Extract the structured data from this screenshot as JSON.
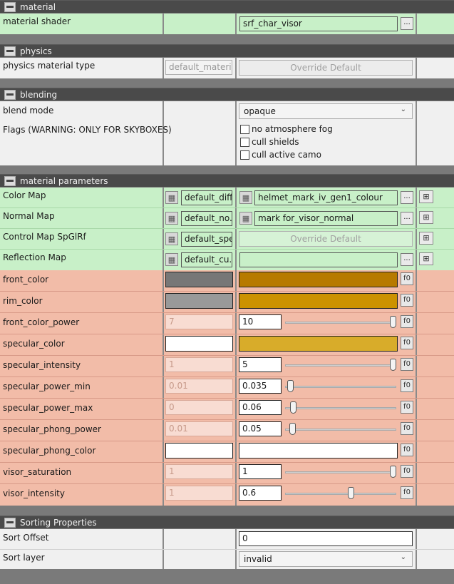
{
  "sections": {
    "material": "material",
    "physics": "physics",
    "blending": "blending",
    "params": "material parameters",
    "sorting": "Sorting Properties"
  },
  "material": {
    "shader_label": "material shader",
    "shader_value": "srf_char_visor",
    "browse": "..."
  },
  "physics": {
    "type_label": "physics material type",
    "default": "default_material",
    "override": "Override Default"
  },
  "blending": {
    "mode_label": "blend mode",
    "mode_value": "opaque",
    "flags_label": "Flags (WARNING: ONLY FOR SKYBOXES)",
    "flags": [
      "no atmosphere fog",
      "cull shields",
      "cull active camo"
    ]
  },
  "textures": [
    {
      "label": "Color Map",
      "default": "default_diff",
      "value": "helmet_mark_iv_gen1_colour"
    },
    {
      "label": "Normal Map",
      "default": "default_no...",
      "value": "mark for_visor_normal"
    },
    {
      "label": "Control Map SpGlRf",
      "default": "default_spec",
      "value": "Override Default"
    },
    {
      "label": "Reflection Map",
      "default": "default_cu...",
      "value": ""
    }
  ],
  "colors": {
    "front_color": {
      "label": "front_color",
      "default": "#777777",
      "value": "#b77a00"
    },
    "rim_color": {
      "label": "rim_color",
      "default": "#999999",
      "value": "#cc9200"
    },
    "specular_color": {
      "label": "specular_color",
      "default": "#ffffff",
      "value": "#d8ac2a"
    },
    "specular_phong_color": {
      "label": "specular_phong_color",
      "default": "#ffffff",
      "value": "#ffffff"
    }
  },
  "scalars": {
    "front_color_power": {
      "label": "front_color_power",
      "default": "7",
      "value": "10",
      "slider": 1.0
    },
    "specular_intensity": {
      "label": "specular_intensity",
      "default": "1",
      "value": "5",
      "slider": 1.0
    },
    "specular_power_min": {
      "label": "specular_power_min",
      "default": "0.01",
      "value": "0.035",
      "slider": 0.02
    },
    "specular_power_max": {
      "label": "specular_power_max",
      "default": "0",
      "value": "0.06",
      "slider": 0.05
    },
    "specular_phong_power": {
      "label": "specular_phong_power",
      "default": "0.01",
      "value": "0.05",
      "slider": 0.04
    },
    "visor_saturation": {
      "label": "visor_saturation",
      "default": "1",
      "value": "1",
      "slider": 1.0
    },
    "visor_intensity": {
      "label": "visor_intensity",
      "default": "1",
      "value": "0.6",
      "slider": 0.6
    }
  },
  "f0_label": "f0",
  "sorting": {
    "offset_label": "Sort Offset",
    "offset_value": "0",
    "layer_label": "Sort layer",
    "layer_value": "invalid"
  },
  "icons": {
    "texture": "texture-thumbnail-icon",
    "add": "add-layer-icon",
    "collapse": "collapse-icon",
    "chevron": "chevron-down-icon"
  }
}
